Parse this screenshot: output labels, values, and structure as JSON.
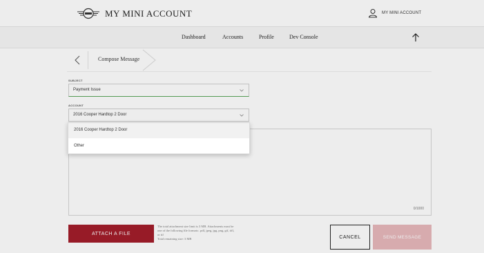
{
  "header": {
    "brand": "MY MINI ACCOUNT",
    "account_label": "MY MINI ACCOUNT",
    "logo_icon": "mini-wings-logo",
    "account_icon": "user-icon"
  },
  "nav": {
    "items": [
      "Dashboard",
      "Accounts",
      "Profile",
      "Dev Console"
    ],
    "up_icon": "arrow-up-icon"
  },
  "breadcrumb": {
    "back_icon": "chevron-left-icon",
    "title": "Compose Message"
  },
  "form": {
    "subject": {
      "label": "SUBJECT",
      "value": "Payment Issue"
    },
    "account": {
      "label": "ACCOUNT",
      "value": "2016 Cooper Hardtop 2 Door",
      "options": [
        "2016 Cooper Hardtop 2 Door",
        "Other"
      ]
    },
    "message": {
      "counter": "0/1000"
    }
  },
  "actions": {
    "attach_label": "ATTACH A FILE",
    "attach_info": [
      "The total attachment size limit is 3 MB. Attachments must be",
      "one of the following file formats: .pdf, jpeg, jpg, png, gif, tiff,",
      "or tif",
      "Total remaining size: 3 MB"
    ],
    "cancel_label": "CANCEL",
    "send_label": "SEND MESSAGE"
  },
  "colors": {
    "accent_red": "#a31e2b",
    "send_disabled": "#e8b8bc",
    "focus_green": "#5aa55a"
  }
}
